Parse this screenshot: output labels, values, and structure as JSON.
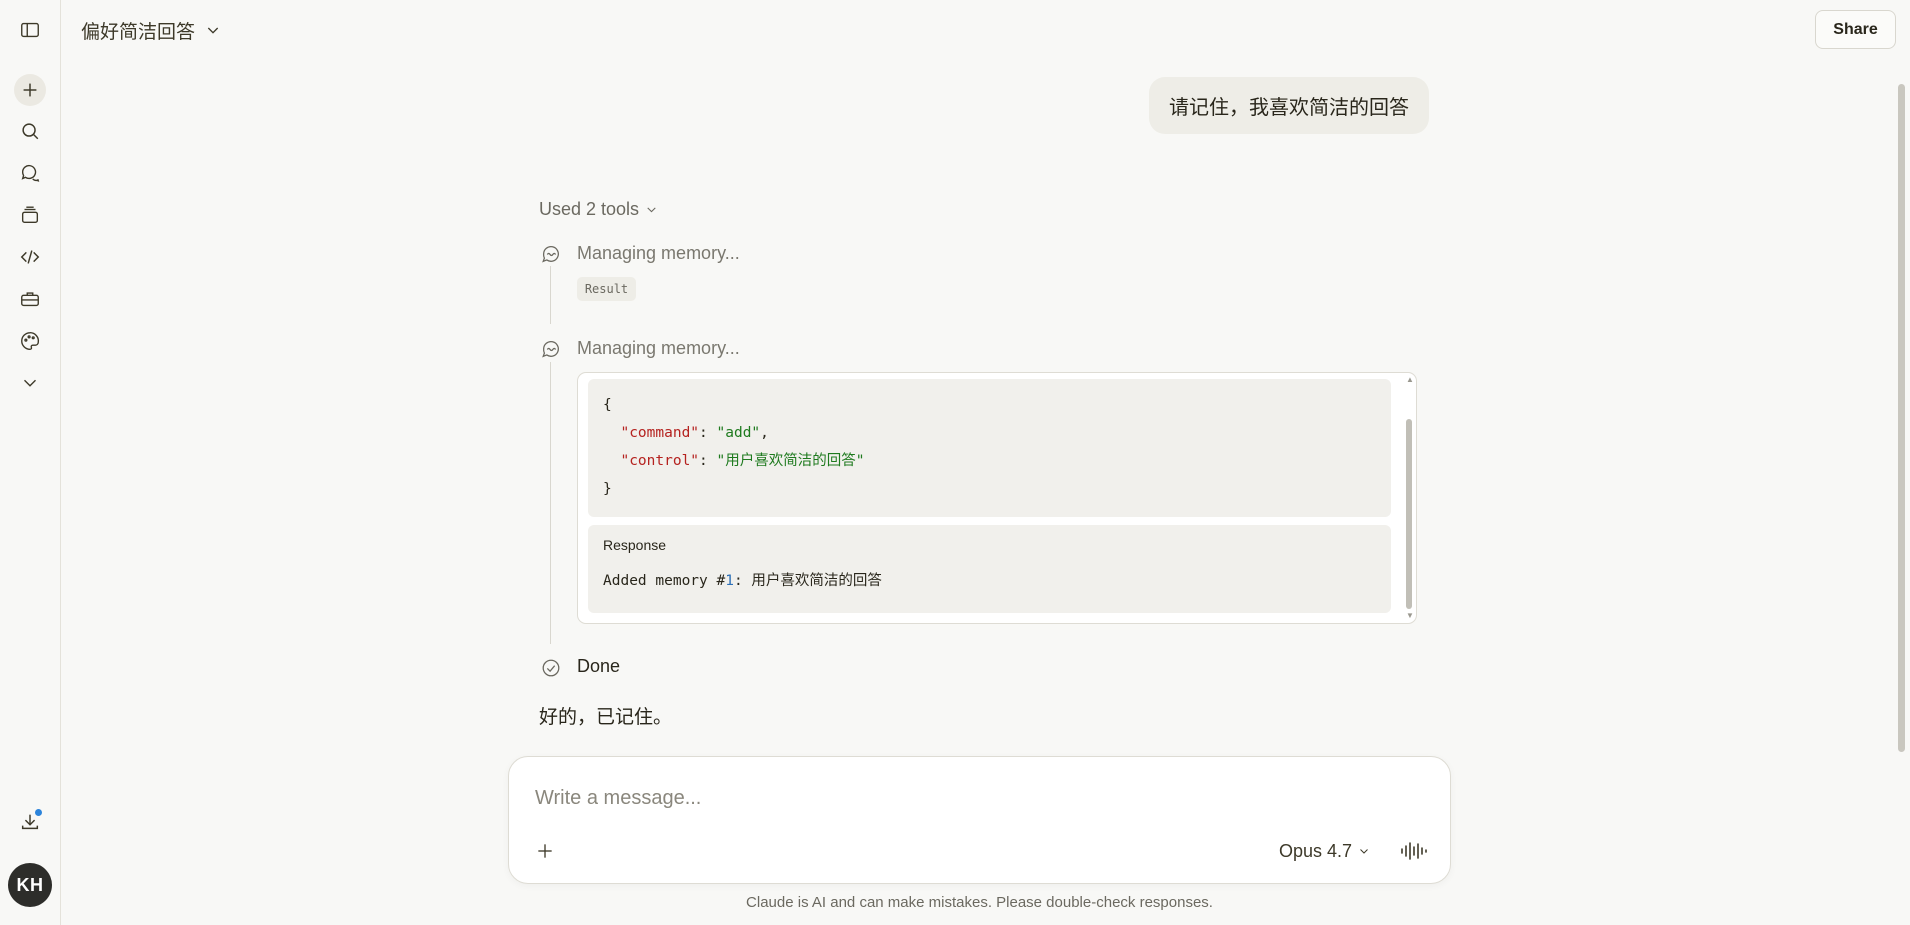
{
  "sidebar": {
    "avatar_initials": "KH",
    "notification_color": "#2c84db"
  },
  "header": {
    "title": "偏好简洁回答",
    "share_label": "Share"
  },
  "messages": {
    "user": "请记住，我喜欢简洁的回答",
    "tools_summary": "Used 2 tools",
    "steps": [
      {
        "label": "Managing memory...",
        "result_label": "Result"
      },
      {
        "label": "Managing memory..."
      }
    ],
    "code": {
      "brace_open": "{",
      "key1": "\"command\"",
      "val1": "\"add\"",
      "key2": "\"control\"",
      "val2": "\"用户喜欢简洁的回答\"",
      "brace_close": "}"
    },
    "response": {
      "title": "Response",
      "prefix": "Added memory #",
      "number": "1",
      "suffix": ": 用户喜欢简洁的回答"
    },
    "done_label": "Done",
    "assistant_reply": "好的，已记住。"
  },
  "composer": {
    "placeholder": "Write a message...",
    "model": "Opus 4.7"
  },
  "footer": {
    "disclaimer": "Claude is AI and can make mistakes. Please double-check responses."
  }
}
